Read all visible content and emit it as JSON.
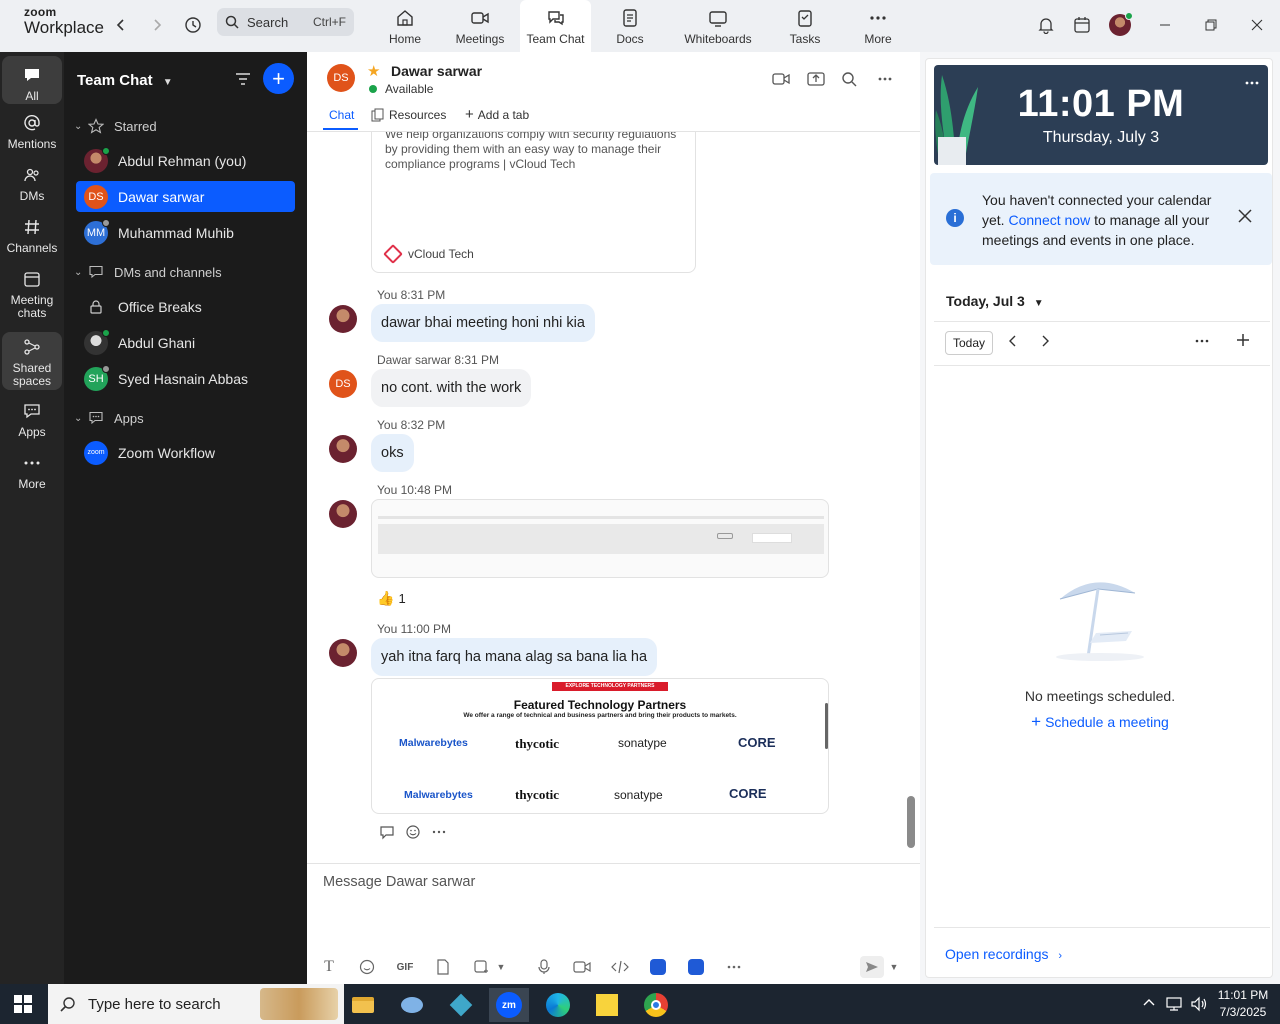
{
  "app": {
    "brand_top": "zoom",
    "brand_bottom": "Workplace"
  },
  "search": {
    "label": "Search",
    "shortcut": "Ctrl+F"
  },
  "nav_tabs": [
    {
      "label": "Home",
      "icon": "home-icon"
    },
    {
      "label": "Meetings",
      "icon": "video-camera-icon"
    },
    {
      "label": "Team Chat",
      "icon": "chat-bubbles-icon",
      "active": true
    },
    {
      "label": "Docs",
      "icon": "document-icon"
    },
    {
      "label": "Whiteboards",
      "icon": "whiteboard-icon"
    },
    {
      "label": "Tasks",
      "icon": "clipboard-icon"
    },
    {
      "label": "More",
      "icon": "more-dots-icon"
    }
  ],
  "rail": [
    {
      "label": "All",
      "icon": "chat-icon",
      "active": true
    },
    {
      "label": "Mentions",
      "icon": "at-icon"
    },
    {
      "label": "DMs",
      "icon": "people-icon"
    },
    {
      "label": "Channels",
      "icon": "hash-icon"
    },
    {
      "label": "Meeting chats",
      "icon": "calendar-icon"
    },
    {
      "label": "Shared spaces",
      "icon": "shared-spaces-icon"
    },
    {
      "label": "Apps",
      "icon": "apps-icon"
    },
    {
      "label": "More",
      "icon": "more-dots-icon"
    }
  ],
  "sidebar": {
    "title": "Team Chat",
    "starred_label": "Starred",
    "starred": [
      {
        "name": "Abdul Rehman (you)",
        "initials": "",
        "status_color": "#1aa34a"
      },
      {
        "name": "Dawar sarwar",
        "initials": "DS",
        "avatar_color": "#e0531a",
        "selected": true
      },
      {
        "name": "Muhammad Muhib",
        "initials": "MM",
        "avatar_color": "#2d6fd6",
        "status_color": "#999999"
      }
    ],
    "dms_label": "DMs and channels",
    "dms": [
      {
        "name": "Office Breaks",
        "icon": "lock-icon"
      },
      {
        "name": "Abdul Ghani",
        "initials": "",
        "status_color": "#1aa34a"
      },
      {
        "name": "Syed Hasnain Abbas",
        "initials": "SH",
        "avatar_color": "#22a35a",
        "status_color": "#999999"
      }
    ],
    "apps_label": "Apps",
    "apps": [
      {
        "name": "Zoom Workflow",
        "initials": "zoom",
        "avatar_color": "#0b5cff"
      }
    ]
  },
  "chat": {
    "contact_name": "Dawar sarwar",
    "contact_initials": "DS",
    "status": "Available",
    "tabs": {
      "chat": "Chat",
      "resources": "Resources",
      "add": "Add a tab"
    },
    "link_preview": {
      "text": "We help organizations comply with security regulations by providing them with an easy way to manage their compliance programs | vCloud Tech",
      "site": "vCloud Tech"
    },
    "messages": [
      {
        "meta": "You 8:31 PM",
        "text": "dawar bhai meeting honi nhi kia"
      },
      {
        "meta": "Dawar sarwar 8:31 PM",
        "text": "no cont. with the work"
      },
      {
        "meta": "You 8:32 PM",
        "text": "oks"
      },
      {
        "meta": "You 10:48 PM",
        "reaction": "👍",
        "reaction_count": "1"
      },
      {
        "meta": "You 11:00 PM",
        "text": "yah itna farq ha mana alag sa bana lia ha"
      }
    ],
    "partners_image": {
      "tag": "EXPLORE TECHNOLOGY PARTNERS",
      "heading": "Featured Technology Partners",
      "subheading": "We offer a range of technical and business partners and bring their products to markets.",
      "logos": [
        "Malwarebytes",
        "thycotic",
        "sonatype",
        "CORE",
        "Malwarebytes",
        "thycotic",
        "sonatype",
        "CORE"
      ]
    },
    "compose_placeholder": "Message Dawar sarwar",
    "compose_gif": "GIF"
  },
  "calendar": {
    "time": "11:01 PM",
    "date": "Thursday, July 3",
    "banner_pre": "You haven't connected your calendar yet. ",
    "banner_link": "Connect now",
    "banner_post": " to manage all your meetings and events in one place.",
    "day_heading": "Today, Jul 3",
    "today_button": "Today",
    "empty": "No meetings scheduled.",
    "schedule": "Schedule a meeting",
    "open_recordings": "Open recordings"
  },
  "taskbar": {
    "search_placeholder": "Type here to search",
    "time": "11:01 PM",
    "date": "7/3/2025"
  },
  "colors": {
    "accent": "#0b5cff",
    "rail_bg": "#242424",
    "sidebar_bg": "#1b1b1b",
    "my_bubble": "#e6f0fb"
  }
}
